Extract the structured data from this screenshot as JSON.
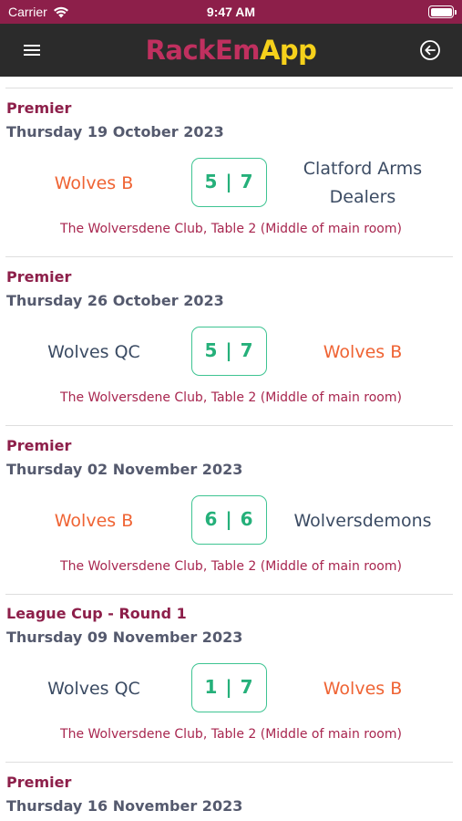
{
  "status_bar": {
    "carrier": "Carrier",
    "time": "9:47 AM"
  },
  "header": {
    "logo_part1": "RackEm",
    "logo_part2": "App",
    "menu_icon": "hamburger-menu-icon",
    "back_icon": "circled-back-arrow-icon"
  },
  "colors": {
    "status_bar": "#8d1f4a",
    "nav_bar": "#2b2b2b",
    "logo_rackem": "#c0305f",
    "logo_app": "#f6d11b",
    "team_highlight": "#ef6333",
    "team_normal": "#3b4b63",
    "score": "#25b07a",
    "competition": "#8d1f4a",
    "venue": "#a8264f"
  },
  "fixtures": [
    {
      "competition": "Premier",
      "date": "Thursday 19 October 2023",
      "home": "Wolves B",
      "score": "5 | 7",
      "away": "Clatford Arms Dealers",
      "venue": "The Wolversdene Club, Table 2 (Middle of main room)"
    },
    {
      "competition": "Premier",
      "date": "Thursday 26 October 2023",
      "home": "Wolves QC",
      "score": "5 | 7",
      "away": "Wolves B",
      "venue": "The Wolversdene Club, Table 2 (Middle of main room)"
    },
    {
      "competition": "Premier",
      "date": "Thursday 02 November 2023",
      "home": "Wolves B",
      "score": "6 | 6",
      "away": "Wolversdemons",
      "venue": "The Wolversdene Club, Table 2 (Middle of main room)"
    },
    {
      "competition": "League Cup - Round 1",
      "date": "Thursday 09 November 2023",
      "home": "Wolves QC",
      "score": "1 | 7",
      "away": "Wolves B",
      "venue": "The Wolversdene Club, Table 2 (Middle of main room)"
    },
    {
      "competition": "Premier",
      "date": "Thursday 16 November 2023"
    }
  ]
}
